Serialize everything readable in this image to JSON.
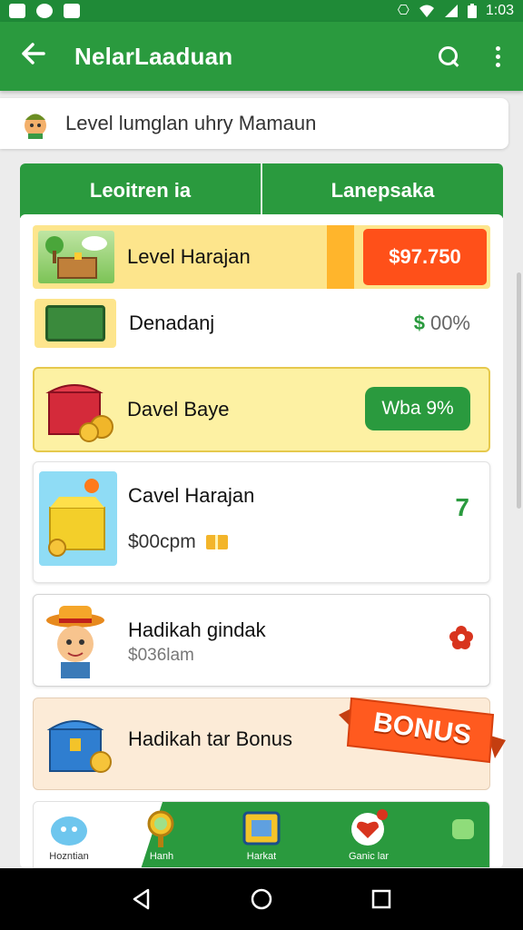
{
  "status_bar": {
    "time": "1:03",
    "left_icons": [
      "photo-icon",
      "chat-icon",
      "notification-icon"
    ],
    "right_icons": [
      "vibrate-icon",
      "wifi-icon",
      "signal-icon",
      "battery-icon"
    ]
  },
  "app_bar": {
    "title": "NelarLaaduan",
    "icons": [
      "back-arrow-icon",
      "search-icon",
      "more-vert-icon"
    ]
  },
  "level_banner": {
    "label": "Level lumglan uhry Mamaun",
    "icon": "character-avatar-icon"
  },
  "tabs": [
    {
      "label": "Leoitren ia"
    },
    {
      "label": "Lanepsaka"
    }
  ],
  "rows": [
    {
      "title": "Level Harajan",
      "price": "$97.750",
      "icon": "treasure-cart-icon"
    },
    {
      "title": "Denadanj",
      "value": "00%",
      "value_icon": "$",
      "icon": "green-chest-icon"
    },
    {
      "title": "Davel Baye",
      "badge": "Wba 9%",
      "icon": "red-chest-icon"
    },
    {
      "title": "Cavel Harajan",
      "subtitle": "$00cpm",
      "count": "7",
      "icon": "yellow-treasure-icon",
      "sub_icon": "ticket-icon"
    },
    {
      "title": "Hadikah gindak",
      "subtitle": "$036lam",
      "icon": "farmer-character-icon",
      "action_icon": "flower-icon"
    },
    {
      "title": "Hadikah tar Bonus",
      "ribbon": "BONUS",
      "icon": "blue-chest-icon"
    }
  ],
  "bottom_nav": {
    "items": [
      {
        "label": "Hozntian",
        "icon": "blob-icon"
      },
      {
        "label": "Hanh",
        "icon": "magnifier-icon"
      },
      {
        "label": "Harkat",
        "icon": "map-icon"
      },
      {
        "label": "Ganic lar",
        "icon": "heart-badge-icon"
      },
      {
        "label": "",
        "icon": "menu-icon"
      }
    ]
  },
  "colors": {
    "primary_green": "#2a9a3e",
    "price_orange": "#ff5019",
    "row_yellow": "#fde58c",
    "bonus_orange": "#ff5a1f"
  }
}
